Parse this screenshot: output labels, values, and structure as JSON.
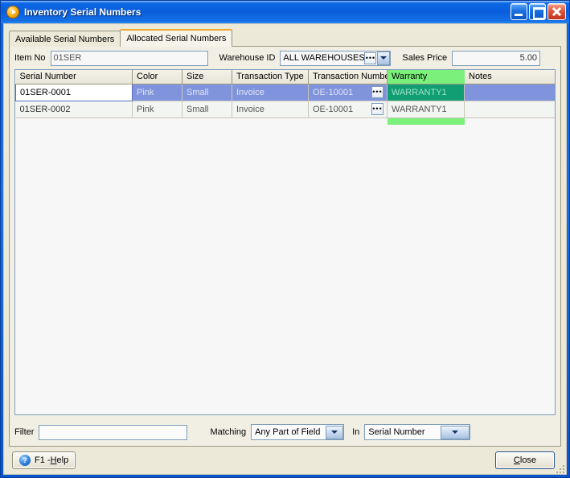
{
  "window": {
    "title": "Inventory Serial Numbers",
    "icon": "app-play-icon",
    "minimize_label": "Minimize",
    "maximize_label": "Maximize",
    "close_label": "Close"
  },
  "tabs": [
    {
      "label": "Available Serial Numbers",
      "active": false
    },
    {
      "label": "Allocated Serial Numbers",
      "active": true
    }
  ],
  "fields": {
    "item_no_label": "Item No",
    "item_no_value": "01SER",
    "warehouse_label": "Warehouse ID",
    "warehouse_value": "ALL WAREHOUSES",
    "lookup_glyph": "•••",
    "sales_price_label": "Sales Price",
    "sales_price_value": "5.00"
  },
  "grid": {
    "columns": [
      "Serial Number",
      "Color",
      "Size",
      "Transaction Type",
      "Transaction Number",
      "Warranty",
      "Notes"
    ],
    "rows": [
      {
        "serial_number": "01SER-0001",
        "color": "Pink",
        "size": "Small",
        "transaction_type": "Invoice",
        "transaction_number": "OE-10001",
        "warranty": "WARRANTY1",
        "notes": "",
        "selected": true
      },
      {
        "serial_number": "01SER-0002",
        "color": "Pink",
        "size": "Small",
        "transaction_type": "Invoice",
        "transaction_number": "OE-10001",
        "warranty": "WARRANTY1",
        "notes": "",
        "selected": false
      }
    ],
    "highlight_color": "#7bf07b",
    "selection_color": "#8094dd"
  },
  "filter": {
    "filter_label": "Filter",
    "filter_value": "",
    "filter_placeholder": "",
    "matching_label": "Matching",
    "matching_value": "Any Part of Field",
    "in_label": "In",
    "field_value": "Serial Number"
  },
  "footer": {
    "help_label_pre": "F1 - ",
    "help_label_accel": "H",
    "help_label_post": "elp",
    "help_icon": "question-mark-icon",
    "close_accel": "C",
    "close_label_post": "lose"
  }
}
